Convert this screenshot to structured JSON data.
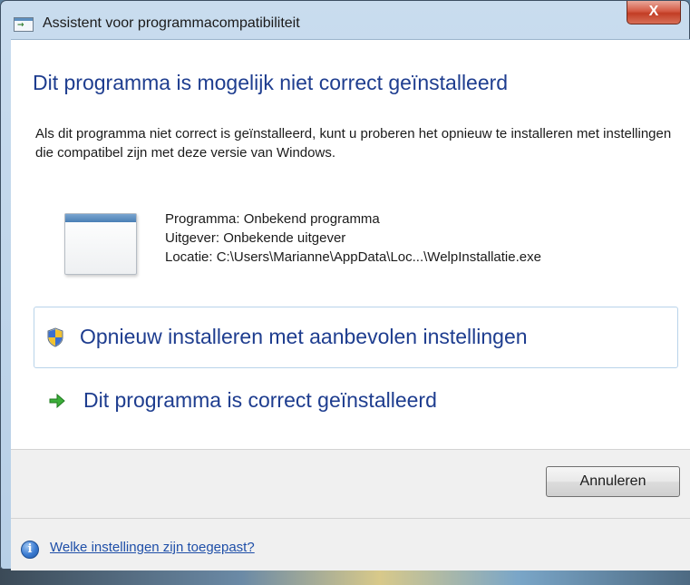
{
  "window": {
    "title": "Assistent voor programmacompatibiliteit",
    "close_label": "X"
  },
  "main": {
    "heading": "Dit programma is mogelijk niet correct geïnstalleerd",
    "description": "Als dit programma niet correct is geïnstalleerd, kunt u proberen het opnieuw te installeren met instellingen die compatibel zijn met deze versie van Windows.",
    "program_info": [
      "Programma: Onbekend programma",
      "Uitgever: Onbekende uitgever",
      "Locatie: C:\\Users\\Marianne\\AppData\\Loc...\\WelpInstallatie.exe"
    ],
    "options": {
      "reinstall_label": "Opnieuw installeren met aanbevolen instellingen",
      "correct_label": "Dit programma is correct geïnstalleerd"
    }
  },
  "footer": {
    "cancel_label": "Annuleren",
    "help_link": "Welke instellingen zijn toegepast?"
  },
  "icons": {
    "title": "compatibility-assistant-icon",
    "program": "program-window-icon",
    "shield": "uac-shield-icon",
    "arrow": "green-arrow-icon",
    "info": "info-icon"
  },
  "colors": {
    "heading": "#1e3d8f",
    "link": "#1f4fa8",
    "close": "#c23d25"
  }
}
